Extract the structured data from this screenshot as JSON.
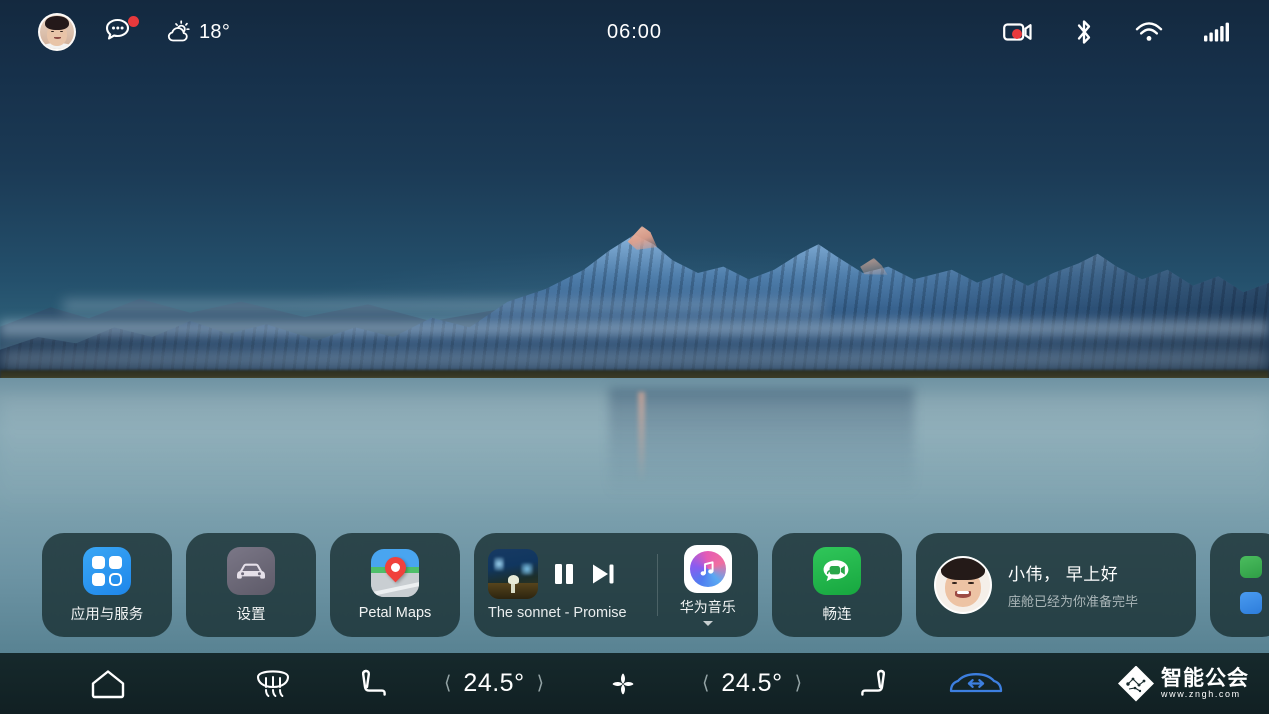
{
  "statusbar": {
    "avatar_name": "user-avatar",
    "message_icon": "message-bubble-icon",
    "weather": {
      "icon": "sun-behind-cloud-icon",
      "temperature": "18°"
    },
    "clock": "06:00",
    "right_icons": [
      {
        "name": "dashcam-recording-icon",
        "label": "Dashcam"
      },
      {
        "name": "bluetooth-icon",
        "label": "Bluetooth"
      },
      {
        "name": "wifi-icon",
        "label": "Wi-Fi"
      },
      {
        "name": "cellular-signal-icon",
        "label": "Signal"
      }
    ]
  },
  "dock": {
    "apps": [
      {
        "icon": "apps-grid-icon",
        "label": "应用与服务"
      },
      {
        "icon": "car-settings-icon",
        "label": "设置"
      },
      {
        "icon": "petal-maps-icon",
        "label": "Petal Maps"
      }
    ],
    "media": {
      "album_art": "album-art-thumbnail",
      "pause_icon": "pause-icon",
      "next_icon": "next-track-icon",
      "track_title": "The sonnet - Promise",
      "app_icon": "huawei-music-icon",
      "app_label": "华为音乐",
      "expand_icon": "caret-down-icon"
    },
    "meetime": {
      "icon": "meetime-icon",
      "label": "畅连"
    },
    "greeting": {
      "avatar": "greeting-avatar",
      "title": "小伟， 早上好",
      "subtitle": "座舱已经为你准备完毕"
    },
    "edge_card": {
      "icons": [
        {
          "name": "green-app-icon"
        },
        {
          "name": "blue-app-icon"
        }
      ]
    }
  },
  "bottombar": {
    "home_icon": "home-icon",
    "defrost_icon": "windshield-defrost-icon",
    "seat_left_icon": "driver-seat-icon",
    "left_temp": {
      "value": "24.5°",
      "dec_icon": "chevron-left-icon",
      "inc_icon": "chevron-right-icon"
    },
    "fan_icon": "fan-icon",
    "right_temp": {
      "value": "24.5°",
      "dec_icon": "chevron-left-icon",
      "inc_icon": "chevron-right-icon"
    },
    "seat_right_icon": "passenger-seat-icon",
    "recirculate_icon": "air-recirculation-icon",
    "watermark": {
      "mark": "zngh-logo-icon",
      "name": "智能公会",
      "url": "www.zngh.com"
    }
  },
  "colors": {
    "accent_blue": "#2d7ddb",
    "alert_red": "#e8393c",
    "card_bg": "#172d30",
    "bar_bg": "#16292c"
  }
}
